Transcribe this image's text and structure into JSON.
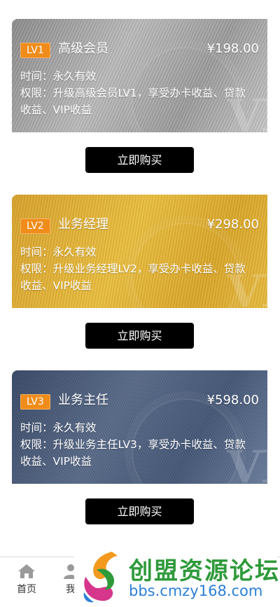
{
  "cards": [
    {
      "level": "LV1",
      "title": "高级会员",
      "price": "¥198.00",
      "validity": "时间：永久有效",
      "rights_line1": "权限：升级高级会员LV1，享受办卡收益、贷款",
      "rights_line2": "收益、VIP收益",
      "button": "立即购买",
      "watermark": "VI"
    },
    {
      "level": "LV2",
      "title": "业务经理",
      "price": "¥298.00",
      "validity": "时间：永久有效",
      "rights_line1": "权限：升级业务经理LV2，享受办卡收益、贷款",
      "rights_line2": "收益、VIP收益",
      "button": "立即购买",
      "watermark": "VI"
    },
    {
      "level": "LV3",
      "title": "业务主任",
      "price": "¥598.00",
      "validity": "时间：永久有效",
      "rights_line1": "权限：升级业务主任LV3，享受办卡收益、贷款",
      "rights_line2": "收益、VIP收益",
      "button": "立即购买",
      "watermark": "VI"
    }
  ],
  "tabbar": {
    "home_label": "首页",
    "home_icon": "home-icon",
    "mine_label": "我",
    "mine_icon": "user-icon"
  },
  "overlay": {
    "brand_name": "创盟资源论坛",
    "url": "bbs.cmzy168.com"
  },
  "colors": {
    "badge": "#f08c1a",
    "button": "#000000",
    "lv1_card": "#a9a9a9",
    "lv2_card": "#e2b234",
    "lv3_card": "#4f6283"
  }
}
